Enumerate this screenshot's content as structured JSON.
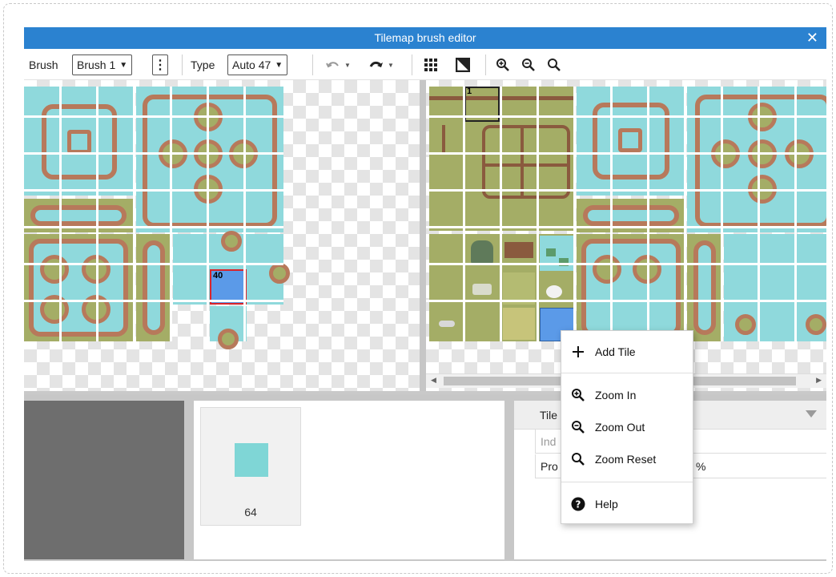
{
  "window": {
    "title": "Tilemap brush editor",
    "close_glyph": "✕"
  },
  "toolbar": {
    "brush_label": "Brush",
    "brush_value": "Brush 1",
    "type_label": "Type",
    "type_value": "Auto 47",
    "icons": [
      "more-options-icon",
      "undo-icon",
      "redo-icon",
      "grid-icon",
      "invert-icon",
      "zoom-in-icon",
      "zoom-out-icon",
      "zoom-reset-icon"
    ]
  },
  "brush_canvas": {
    "selected_tile_number": "40"
  },
  "tileset": {
    "marker_number": "1"
  },
  "tile_list": {
    "tiles": [
      {
        "number": "64",
        "color": "#7fd6d6"
      }
    ]
  },
  "properties": {
    "header": "Tile",
    "rows": [
      {
        "key": "Ind",
        "value": ""
      },
      {
        "key": "Pro",
        "value": "%"
      }
    ]
  },
  "context_menu": {
    "items": [
      {
        "label": "Add Tile",
        "icon": "plus-icon"
      },
      {
        "label": "Zoom In",
        "icon": "zoom-in-icon"
      },
      {
        "label": "Zoom Out",
        "icon": "zoom-out-icon"
      },
      {
        "label": "Zoom Reset",
        "icon": "zoom-reset-icon"
      },
      {
        "label": "Help",
        "icon": "help-icon"
      }
    ]
  },
  "colors": {
    "titlebar": "#2b82d0",
    "water": "#8fd9dc",
    "grass": "#a4ad66",
    "fence": "#b7795b",
    "selection": "#d9242b",
    "highlight_tile": "#5b9ae8"
  }
}
